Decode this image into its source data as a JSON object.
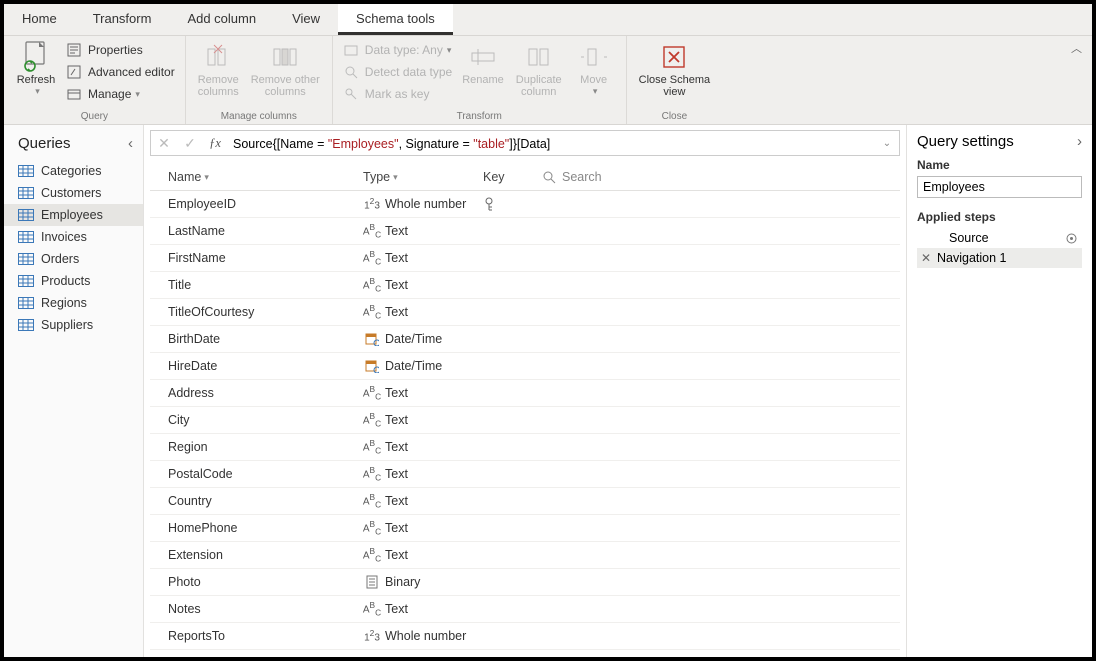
{
  "tabs": [
    "Home",
    "Transform",
    "Add column",
    "View",
    "Schema tools"
  ],
  "active_tab": 4,
  "ribbon": {
    "groups": {
      "query": {
        "label": "Query",
        "refresh": "Refresh",
        "properties": "Properties",
        "advanced_editor": "Advanced editor",
        "manage": "Manage"
      },
      "manage_columns": {
        "label": "Manage columns",
        "remove_columns": "Remove\ncolumns",
        "remove_other_columns": "Remove other\ncolumns"
      },
      "transform": {
        "label": "Transform",
        "data_type": "Data type: Any",
        "detect": "Detect data type",
        "mark_key": "Mark as key",
        "rename": "Rename",
        "duplicate_column": "Duplicate\ncolumn",
        "move": "Move"
      },
      "close": {
        "label": "Close",
        "close_schema": "Close Schema\nview"
      }
    }
  },
  "formula": {
    "prefix": "Source{[Name = ",
    "str1": "\"Employees\"",
    "mid": ", Signature = ",
    "str2": "\"table\"",
    "suffix": "]}[Data]"
  },
  "queries_panel": {
    "title": "Queries",
    "items": [
      "Categories",
      "Customers",
      "Employees",
      "Invoices",
      "Orders",
      "Products",
      "Regions",
      "Suppliers"
    ],
    "selected": 2
  },
  "grid": {
    "headers": {
      "name": "Name",
      "type": "Type",
      "key": "Key",
      "search": "Search"
    },
    "rows": [
      {
        "name": "EmployeeID",
        "type_icon": "num",
        "type": "Whole number",
        "key": true
      },
      {
        "name": "LastName",
        "type_icon": "abc",
        "type": "Text"
      },
      {
        "name": "FirstName",
        "type_icon": "abc",
        "type": "Text"
      },
      {
        "name": "Title",
        "type_icon": "abc",
        "type": "Text"
      },
      {
        "name": "TitleOfCourtesy",
        "type_icon": "abc",
        "type": "Text"
      },
      {
        "name": "BirthDate",
        "type_icon": "date",
        "type": "Date/Time"
      },
      {
        "name": "HireDate",
        "type_icon": "date",
        "type": "Date/Time"
      },
      {
        "name": "Address",
        "type_icon": "abc",
        "type": "Text"
      },
      {
        "name": "City",
        "type_icon": "abc",
        "type": "Text"
      },
      {
        "name": "Region",
        "type_icon": "abc",
        "type": "Text"
      },
      {
        "name": "PostalCode",
        "type_icon": "abc",
        "type": "Text"
      },
      {
        "name": "Country",
        "type_icon": "abc",
        "type": "Text"
      },
      {
        "name": "HomePhone",
        "type_icon": "abc",
        "type": "Text"
      },
      {
        "name": "Extension",
        "type_icon": "abc",
        "type": "Text"
      },
      {
        "name": "Photo",
        "type_icon": "bin",
        "type": "Binary"
      },
      {
        "name": "Notes",
        "type_icon": "abc",
        "type": "Text"
      },
      {
        "name": "ReportsTo",
        "type_icon": "num",
        "type": "Whole number"
      }
    ]
  },
  "settings": {
    "title": "Query settings",
    "name_label": "Name",
    "name_value": "Employees",
    "applied_steps_label": "Applied steps",
    "steps": [
      {
        "label": "Source",
        "gear": true,
        "selected": false,
        "removable": false
      },
      {
        "label": "Navigation 1",
        "gear": false,
        "selected": true,
        "removable": true
      }
    ]
  }
}
